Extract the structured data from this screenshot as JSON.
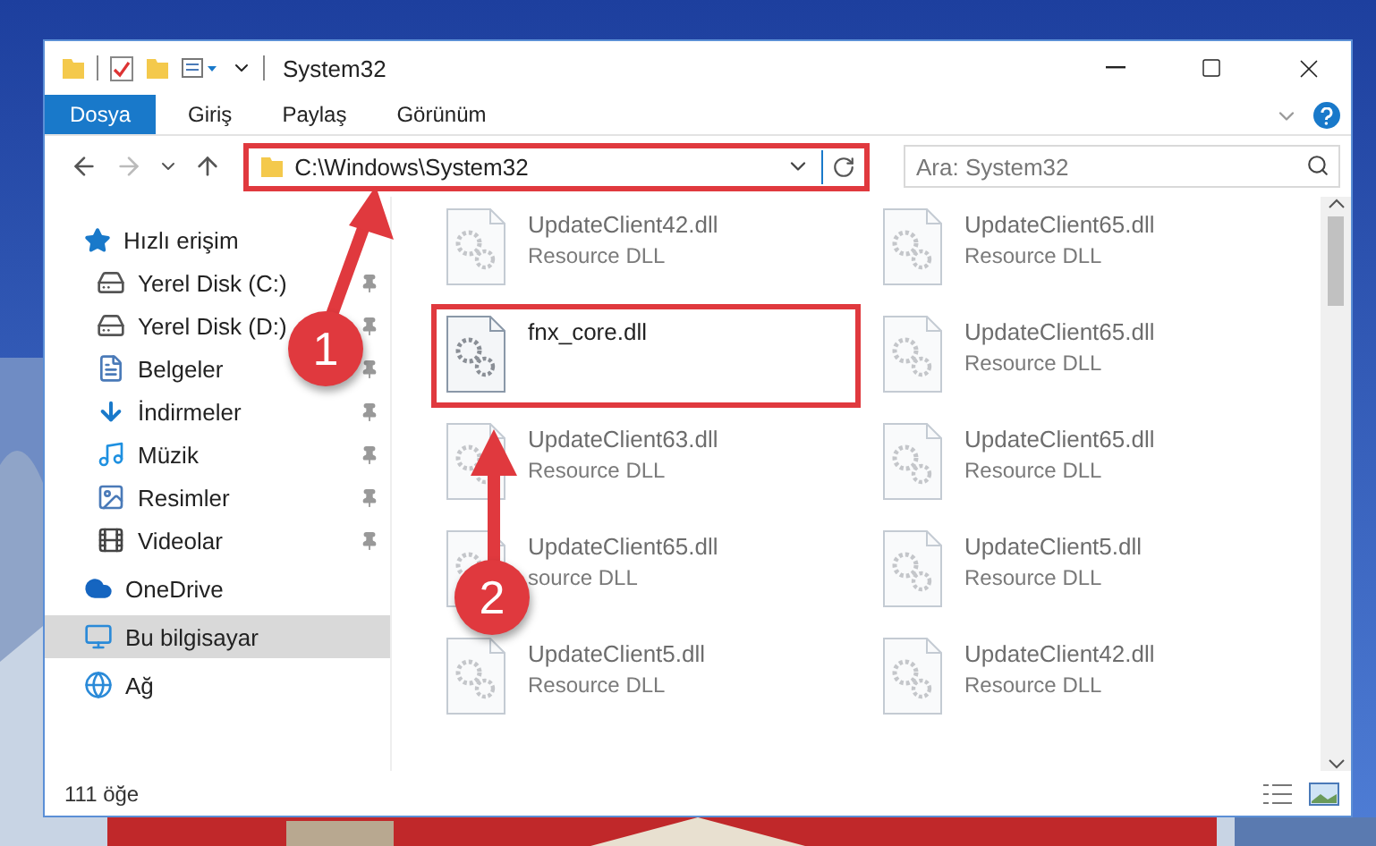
{
  "window": {
    "title": "System32"
  },
  "ribbon_tabs": [
    {
      "label": "Dosya",
      "selected": true
    },
    {
      "label": "Giriş",
      "selected": false
    },
    {
      "label": "Paylaş",
      "selected": false
    },
    {
      "label": "Görünüm",
      "selected": false
    }
  ],
  "address": {
    "path": "C:\\Windows\\System32",
    "highlighted": true
  },
  "search": {
    "placeholder": "Ara: System32"
  },
  "sidebar": {
    "items": [
      {
        "label": "Hızlı erişim",
        "selected": false,
        "children": [
          {
            "label": "Yerel Disk (C:)",
            "pinned": true,
            "selected": false
          },
          {
            "label": "Yerel Disk (D:)",
            "pinned": true,
            "selected": false
          },
          {
            "label": "Belgeler",
            "pinned": true,
            "selected": false
          },
          {
            "label": "İndirmeler",
            "pinned": true,
            "selected": false
          },
          {
            "label": "Müzik",
            "pinned": true,
            "selected": false
          },
          {
            "label": "Resimler",
            "pinned": true,
            "selected": false
          },
          {
            "label": "Videolar",
            "pinned": true,
            "selected": false
          }
        ]
      },
      {
        "label": "OneDrive",
        "selected": false
      },
      {
        "label": "Bu bilgisayar",
        "selected": true
      },
      {
        "label": "Ağ",
        "selected": false
      }
    ]
  },
  "files": [
    {
      "name": "UpdateClient42.dll",
      "type": "Resource DLL",
      "blurred": true,
      "highlighted": false
    },
    {
      "name": "UpdateClient65.dll",
      "type": "Resource DLL",
      "blurred": true,
      "highlighted": false
    },
    {
      "name": "fnx_core.dll",
      "blurred": false,
      "highlighted": true
    },
    {
      "name": "UpdateClient65.dll",
      "type": "Resource DLL",
      "blurred": true,
      "highlighted": false
    },
    {
      "name": "UpdateClient63.dll",
      "type": "Resource DLL",
      "blurred": true,
      "highlighted": false
    },
    {
      "name": "UpdateClient65.dll",
      "type": "Resource DLL",
      "blurred": true,
      "highlighted": false
    },
    {
      "name": "UpdateClient65.dll",
      "type": "source DLL",
      "blurred": true,
      "highlighted": false
    },
    {
      "name": "UpdateClient5.dll",
      "type": "Resource DLL",
      "blurred": true,
      "highlighted": false
    },
    {
      "name": "UpdateClient5.dll",
      "type": "Resource DLL",
      "blurred": true,
      "highlighted": false
    },
    {
      "name": "UpdateClient42.dll",
      "type": "Resource DLL",
      "blurred": true,
      "highlighted": false
    }
  ],
  "status_bar": {
    "count": "111 öğe"
  },
  "annotations": [
    {
      "label": "1"
    },
    {
      "label": "2"
    }
  ]
}
